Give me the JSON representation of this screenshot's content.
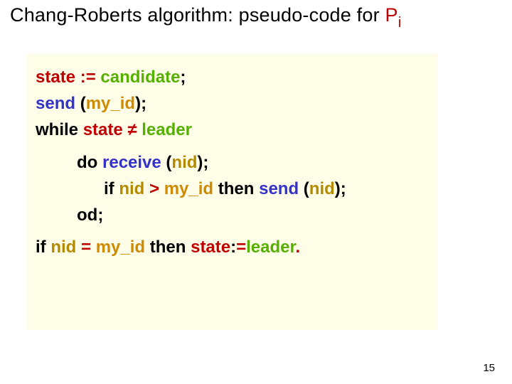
{
  "title": {
    "prefix": "Chang-Roberts algorithm: pseudo-code for ",
    "P": "P",
    "i": "i"
  },
  "code": {
    "kw_send": "send",
    "kw_while": "while",
    "kw_do": "do",
    "kw_receive": "receive",
    "kw_if": "if",
    "kw_then": "then",
    "kw_od": "od",
    "state": "state",
    "candidate": "candidate",
    "leader": "leader",
    "nid": "nid",
    "my_id": "my_id",
    "assign": ":=",
    "neq": "≠",
    "gt": ">",
    "eq": "=",
    "lp": "(",
    "rp": ")",
    "semi": ";",
    "dot": "."
  },
  "page_number": "15"
}
